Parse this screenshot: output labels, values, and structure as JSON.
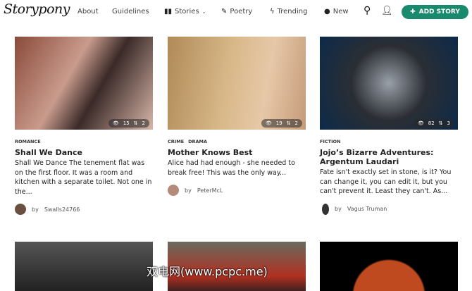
{
  "nav": {
    "logo": "Storypony",
    "about": "About",
    "guidelines": "Guidelines",
    "stories": "Stories",
    "poetry": "Poetry",
    "trending": "Trending",
    "new": "New",
    "add_story": "ADD STORY"
  },
  "cards": [
    {
      "categories": [
        "ROMANCE"
      ],
      "title": "Shall We Dance",
      "excerpt": "Shall We Dance The tenement flat was on the first floor.  It was a room and kitchen with a separate toilet. Not one in the...",
      "views": "15",
      "shares": "2",
      "by": "by",
      "author": "Swalls24766"
    },
    {
      "categories": [
        "CRIME",
        "DRAMA"
      ],
      "title": "Mother Knows Best",
      "excerpt": "Alice had had enough - she needed to break free! This was the only way...",
      "views": "19",
      "shares": "2",
      "by": "by",
      "author": "PeterMcL"
    },
    {
      "categories": [
        "FICTION"
      ],
      "title": "Jojo’s Bizarre Adventures: Argentum Laudari",
      "excerpt": "Fate isn't exactly set in stone, is it? You can change it, you can edit it, but you can't prevent it. Least they can't. As...",
      "views": "82",
      "shares": "3",
      "by": "by",
      "author": "Vagus Truman"
    }
  ],
  "watermark": "双电网(www.pcpc.me)",
  "colors": {
    "accent": "#1a8a6e"
  }
}
